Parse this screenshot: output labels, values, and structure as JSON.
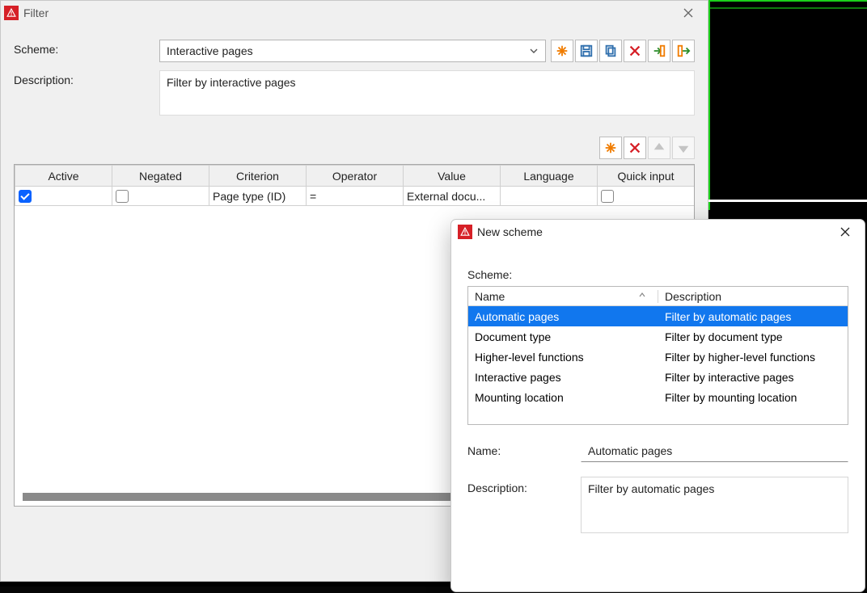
{
  "filter_window": {
    "title": "Filter",
    "labels": {
      "scheme": "Scheme:",
      "description": "Description:"
    },
    "scheme_selected": "Interactive pages",
    "description_value": "Filter by interactive pages",
    "toolbar": {
      "new": "New",
      "save": "Save",
      "copy": "Copy",
      "delete": "Delete",
      "import": "Import",
      "export": "Export"
    },
    "crit_toolbar": {
      "new_row": "New",
      "delete_row": "Delete",
      "move_up": "Move up",
      "move_down": "Move down"
    },
    "table": {
      "headers": {
        "active": "Active",
        "negated": "Negated",
        "criterion": "Criterion",
        "operator": "Operator",
        "value": "Value",
        "language": "Language",
        "quick_input": "Quick input"
      },
      "rows": [
        {
          "active": true,
          "negated": false,
          "criterion": "Page type (ID)",
          "operator": "=",
          "value": "External docu...",
          "language": "",
          "quick_input": false
        }
      ]
    }
  },
  "new_scheme_dialog": {
    "title": "New scheme",
    "labels": {
      "scheme": "Scheme:",
      "name_col": "Name",
      "desc_col": "Description",
      "name": "Name:",
      "description": "Description:"
    },
    "schemes": [
      {
        "name": "Automatic pages",
        "desc": "Filter by automatic pages",
        "selected": true
      },
      {
        "name": "Document type",
        "desc": "Filter by document type",
        "selected": false
      },
      {
        "name": "Higher-level functions",
        "desc": "Filter by higher-level functions",
        "selected": false
      },
      {
        "name": "Interactive pages",
        "desc": "Filter by interactive pages",
        "selected": false
      },
      {
        "name": "Mounting location",
        "desc": "Filter by mounting location",
        "selected": false
      }
    ],
    "name_value": "Automatic pages",
    "description_value": "Filter by automatic pages"
  }
}
